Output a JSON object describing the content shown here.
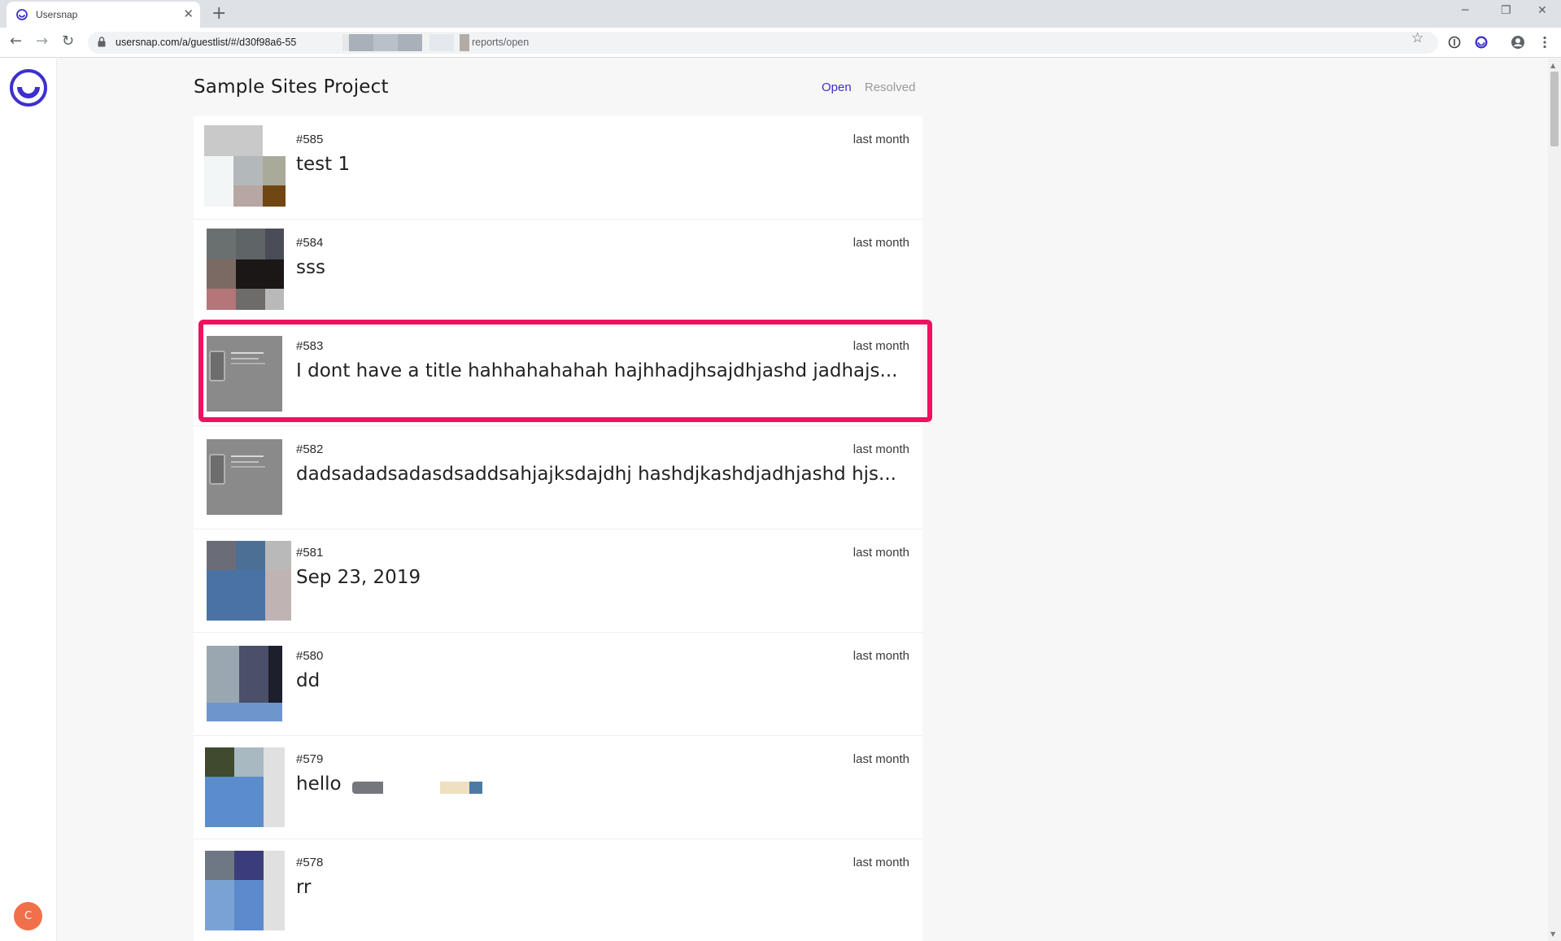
{
  "browser": {
    "tab_title": "Usersnap",
    "tab_close": "✕",
    "new_tab": "+",
    "url": "usersnap.com/a/guestlist/#/d30f98a6-55",
    "url_tail": "reports/open",
    "window_controls": {
      "minimize": "─",
      "restore": "❐",
      "close": "✕"
    },
    "nav": {
      "back": "←",
      "forward": "→",
      "reload": "↻"
    },
    "star": "☆"
  },
  "app": {
    "user_initial": "C",
    "brand_color": "#3d2fd0"
  },
  "page": {
    "title": "Sample Sites Project",
    "tabs": [
      {
        "label": "Open",
        "active": true,
        "color": "#3d2fd0"
      },
      {
        "label": "Resolved",
        "active": false,
        "color": "#9a9a9a"
      }
    ]
  },
  "reports": [
    {
      "id": "#585",
      "time": "last month",
      "title": "test 1"
    },
    {
      "id": "#584",
      "time": "last month",
      "title": "sss"
    },
    {
      "id": "#583",
      "time": "last month",
      "title": "I dont have a title hahhahahahah hajhhadjhsajdhjashd jadhajs...",
      "highlighted": true
    },
    {
      "id": "#582",
      "time": "last month",
      "title": "dadsadadsadasdsaddsahjajksdajdhj hashdjkashdjadhjashd hjs..."
    },
    {
      "id": "#581",
      "time": "last month",
      "title": "Sep 23, 2019"
    },
    {
      "id": "#580",
      "time": "last month",
      "title": "dd"
    },
    {
      "id": "#579",
      "time": "last month",
      "title": "hello"
    },
    {
      "id": "#578",
      "time": "last month",
      "title": "rr"
    }
  ],
  "highlight_color": "#f0115f"
}
